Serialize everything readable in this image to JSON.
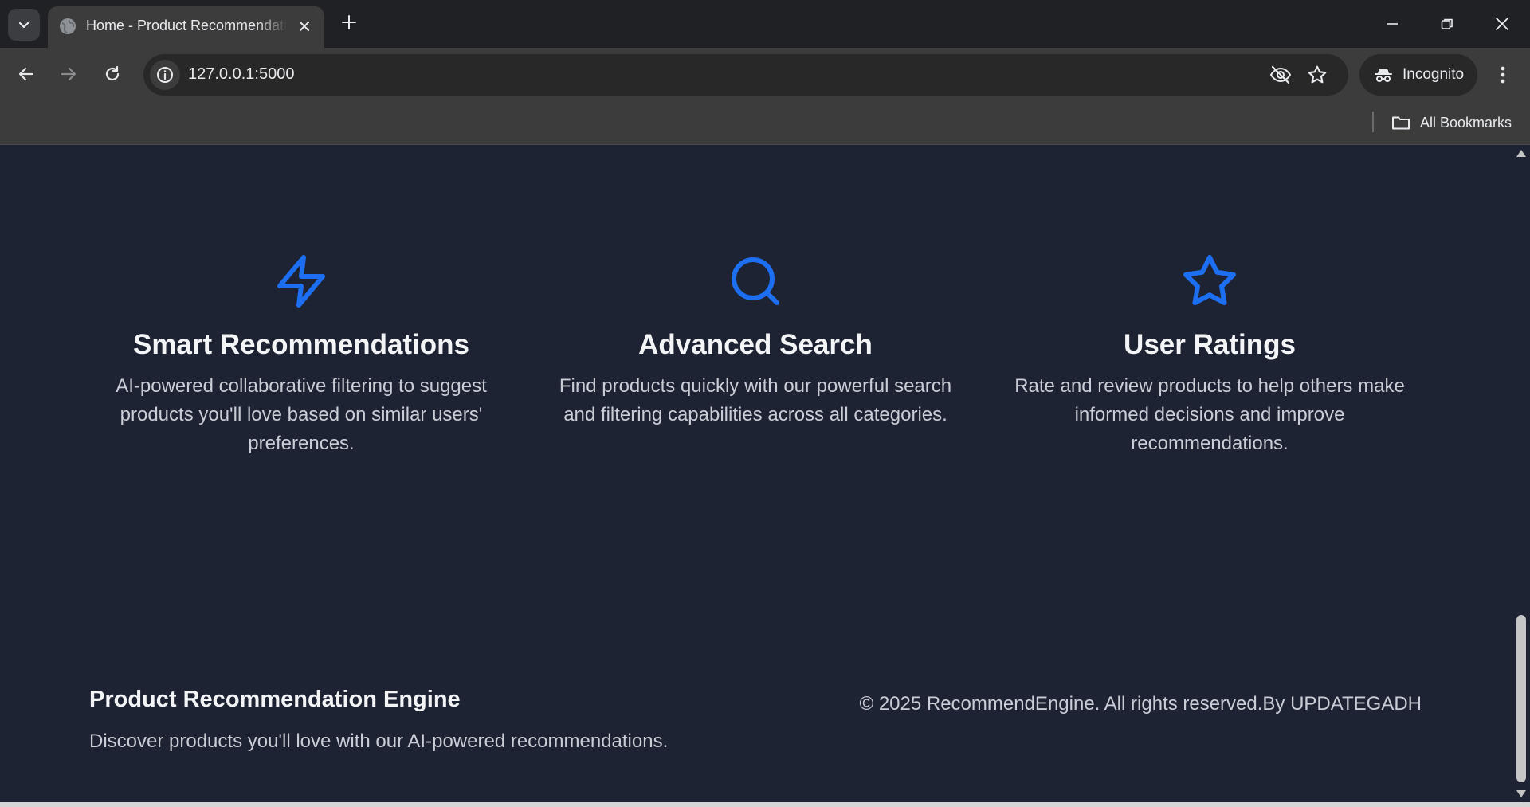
{
  "browser": {
    "tab_title": "Home - Product Recommendation Engine",
    "url": "127.0.0.1:5000",
    "incognito_label": "Incognito",
    "bookmarks_label": "All Bookmarks"
  },
  "features": [
    {
      "icon": "lightning-icon",
      "title": "Smart Recommendations",
      "description": "AI-powered collaborative filtering to suggest products you'll love based on similar users' preferences."
    },
    {
      "icon": "search-icon",
      "title": "Advanced Search",
      "description": "Find products quickly with our powerful search and filtering capabilities across all categories."
    },
    {
      "icon": "star-icon",
      "title": "User Ratings",
      "description": "Rate and review products to help others make informed decisions and improve recommendations."
    }
  ],
  "footer": {
    "title": "Product Recommendation Engine",
    "tagline": "Discover products you'll love with our AI-powered recommendations.",
    "copyright": "© 2025 RecommendEngine. All rights reserved.By UPDATEGADH"
  },
  "colors": {
    "page_background": "#1e2333",
    "accent": "#1d6ff2",
    "heading": "#f3f4f6",
    "body_text": "#c8cdd6"
  }
}
